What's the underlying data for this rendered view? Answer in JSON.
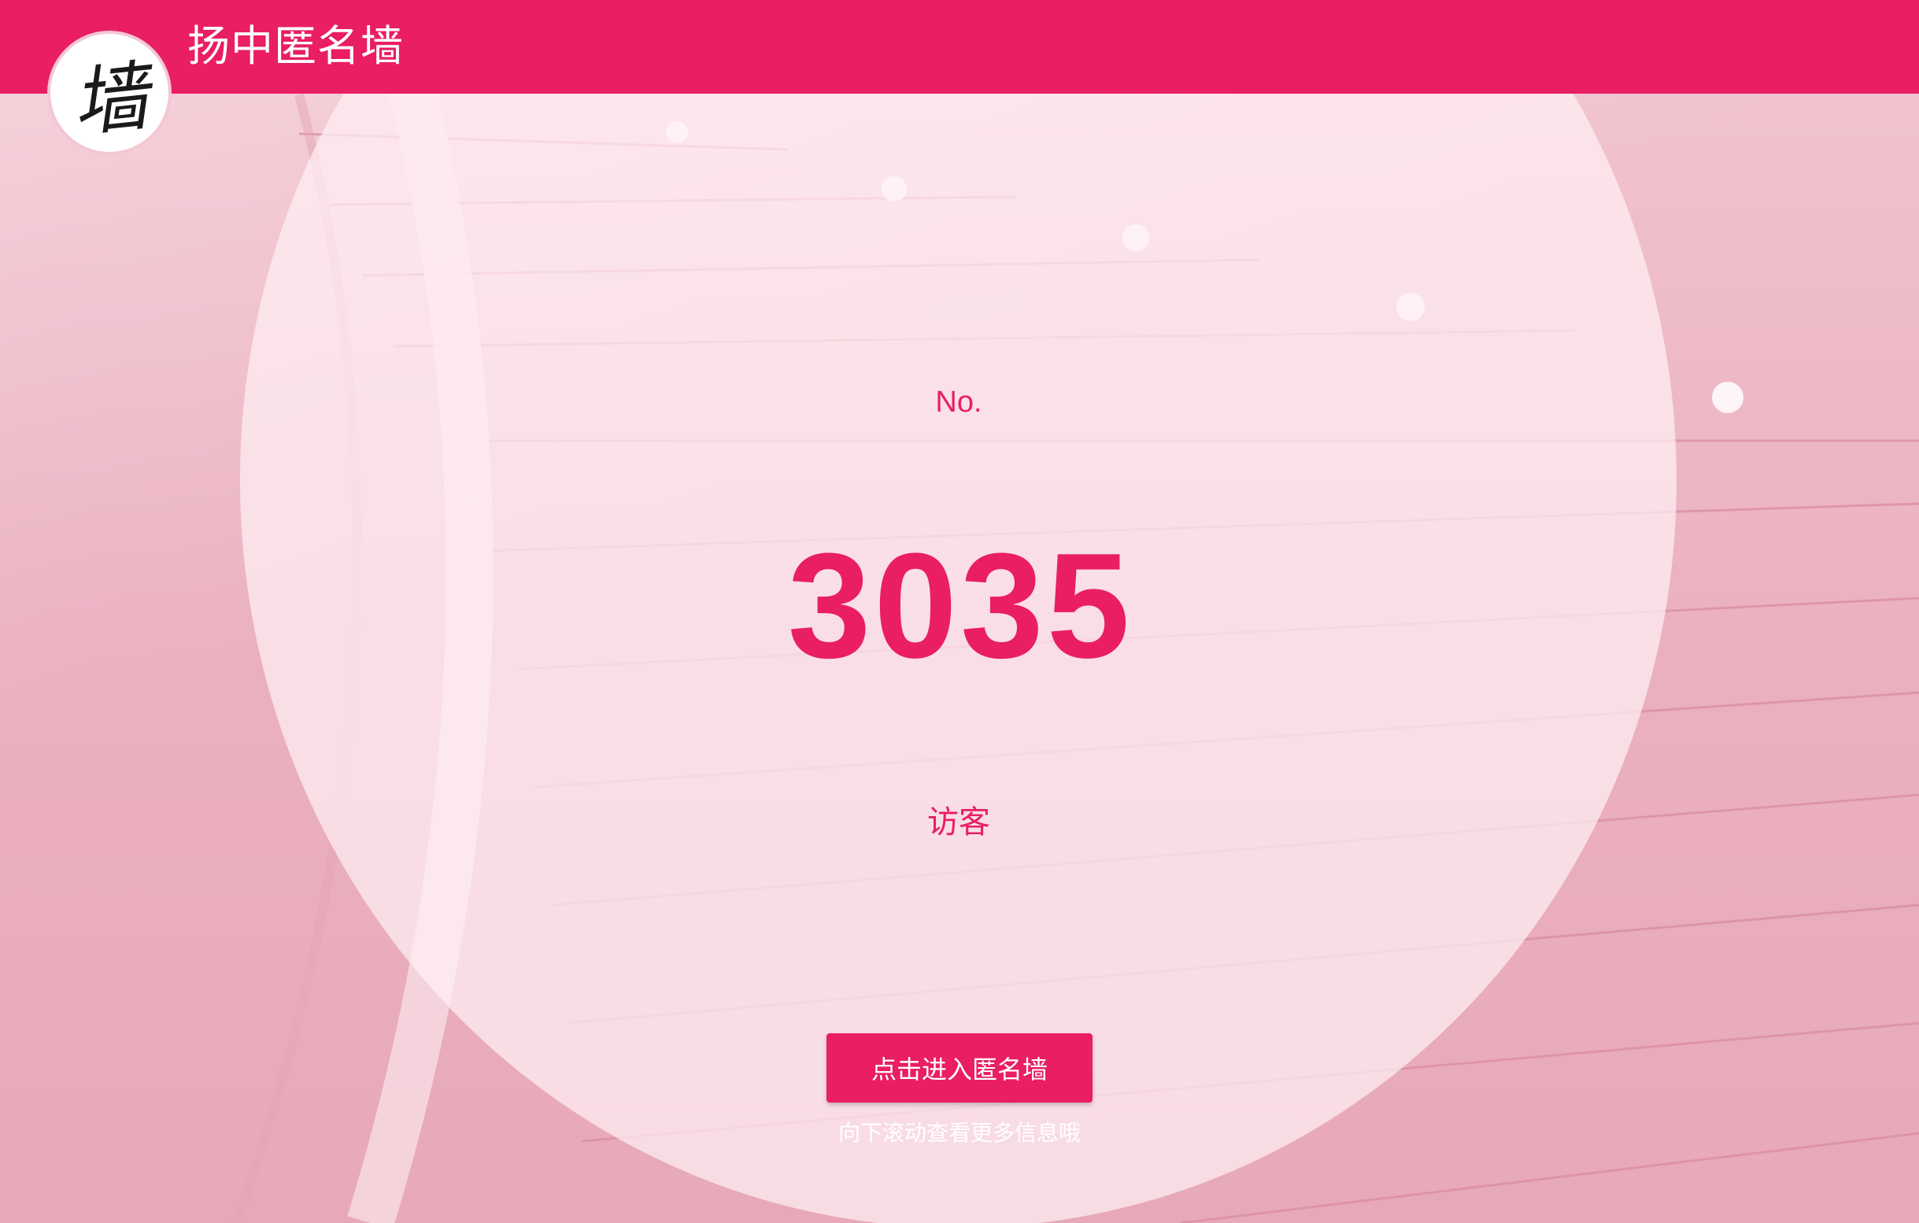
{
  "header": {
    "title": "扬中匿名墙",
    "logo_char": "墙",
    "brand_color": "#e91e63"
  },
  "main": {
    "number_prefix": "No.",
    "visitor_count": "3035",
    "visitor_label": "访客",
    "enter_button_label": "点击进入匿名墙",
    "scroll_hint": "向下滚动查看更多信息哦"
  }
}
